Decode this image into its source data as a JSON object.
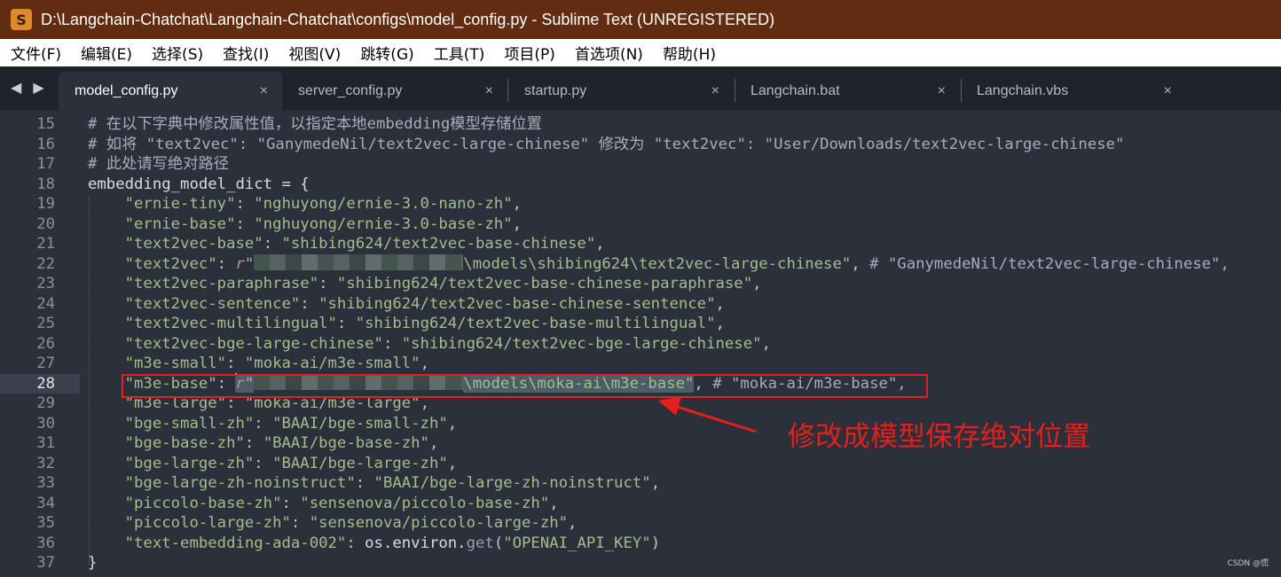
{
  "window": {
    "title": "D:\\Langchain-Chatchat\\Langchain-Chatchat\\configs\\model_config.py - Sublime Text (UNREGISTERED)",
    "app_icon_glyph": "S"
  },
  "menu": [
    "文件(F)",
    "编辑(E)",
    "选择(S)",
    "查找(I)",
    "视图(V)",
    "跳转(G)",
    "工具(T)",
    "项目(P)",
    "首选项(N)",
    "帮助(H)"
  ],
  "tabs": [
    {
      "label": "model_config.py",
      "active": true
    },
    {
      "label": "server_config.py",
      "active": false
    },
    {
      "label": "startup.py",
      "active": false
    },
    {
      "label": "Langchain.bat",
      "active": false
    },
    {
      "label": "Langchain.vbs",
      "active": false
    }
  ],
  "tab_close_glyph": "×",
  "nav_arrows": "◀ ▶",
  "current_line": 28,
  "code_lines": [
    {
      "n": "15",
      "parts": [
        {
          "t": "# 在以下字典中修改属性值，以指定本地embedding模型存储位置",
          "c": "c-comment"
        }
      ]
    },
    {
      "n": "16",
      "parts": [
        {
          "t": "# 如将 \"text2vec\": \"GanymedeNil/text2vec-large-chinese\" 修改为 \"text2vec\": \"User/Downloads/text2vec-large-chinese\"",
          "c": "c-comment"
        }
      ]
    },
    {
      "n": "17",
      "parts": [
        {
          "t": "# 此处请写绝对路径",
          "c": "c-comment"
        }
      ]
    },
    {
      "n": "18",
      "parts": [
        {
          "t": "embedding_model_dict = {",
          "c": "c-plain"
        }
      ]
    },
    {
      "n": "19",
      "parts": [
        {
          "t": "    \"ernie-tiny\"",
          "c": "c-key"
        },
        {
          "t": ": ",
          "c": "c-op"
        },
        {
          "t": "\"nghuyong/ernie-3.0-nano-zh\"",
          "c": "c-str"
        },
        {
          "t": ",",
          "c": "c-op"
        }
      ]
    },
    {
      "n": "20",
      "parts": [
        {
          "t": "    \"ernie-base\"",
          "c": "c-key"
        },
        {
          "t": ": ",
          "c": "c-op"
        },
        {
          "t": "\"nghuyong/ernie-3.0-base-zh\"",
          "c": "c-str"
        },
        {
          "t": ",",
          "c": "c-op"
        }
      ]
    },
    {
      "n": "21",
      "parts": [
        {
          "t": "    \"text2vec-base\"",
          "c": "c-key"
        },
        {
          "t": ": ",
          "c": "c-op"
        },
        {
          "t": "\"shibing624/text2vec-base-chinese\"",
          "c": "c-str"
        },
        {
          "t": ",",
          "c": "c-op"
        }
      ]
    },
    {
      "n": "22",
      "parts": [
        {
          "t": "    \"text2vec\"",
          "c": "c-key"
        },
        {
          "t": ": ",
          "c": "c-op"
        },
        {
          "t": "r",
          "c": "c-prefix"
        },
        {
          "t": "\"",
          "c": "c-str"
        },
        {
          "t": "",
          "c": "redacted"
        },
        {
          "t": "\\models\\shibing624\\text2vec-large-chinese\"",
          "c": "c-str"
        },
        {
          "t": ", ",
          "c": "c-op"
        },
        {
          "t": "# \"GanymedeNil/text2vec-large-chinese\",",
          "c": "c-comment"
        }
      ]
    },
    {
      "n": "23",
      "parts": [
        {
          "t": "    \"text2vec-paraphrase\"",
          "c": "c-key"
        },
        {
          "t": ": ",
          "c": "c-op"
        },
        {
          "t": "\"shibing624/text2vec-base-chinese-paraphrase\"",
          "c": "c-str"
        },
        {
          "t": ",",
          "c": "c-op"
        }
      ]
    },
    {
      "n": "24",
      "parts": [
        {
          "t": "    \"text2vec-sentence\"",
          "c": "c-key"
        },
        {
          "t": ": ",
          "c": "c-op"
        },
        {
          "t": "\"shibing624/text2vec-base-chinese-sentence\"",
          "c": "c-str"
        },
        {
          "t": ",",
          "c": "c-op"
        }
      ]
    },
    {
      "n": "25",
      "parts": [
        {
          "t": "    \"text2vec-multilingual\"",
          "c": "c-key"
        },
        {
          "t": ": ",
          "c": "c-op"
        },
        {
          "t": "\"shibing624/text2vec-base-multilingual\"",
          "c": "c-str"
        },
        {
          "t": ",",
          "c": "c-op"
        }
      ]
    },
    {
      "n": "26",
      "parts": [
        {
          "t": "    \"text2vec-bge-large-chinese\"",
          "c": "c-key"
        },
        {
          "t": ": ",
          "c": "c-op"
        },
        {
          "t": "\"shibing624/text2vec-bge-large-chinese\"",
          "c": "c-str"
        },
        {
          "t": ",",
          "c": "c-op"
        }
      ]
    },
    {
      "n": "27",
      "parts": [
        {
          "t": "    \"m3e-small\"",
          "c": "c-key"
        },
        {
          "t": ": ",
          "c": "c-op"
        },
        {
          "t": "\"moka-ai/m3e-small\"",
          "c": "c-str"
        },
        {
          "t": ",",
          "c": "c-op"
        }
      ]
    },
    {
      "n": "28",
      "parts": [
        {
          "t": "    \"m3e-base\"",
          "c": "c-key"
        },
        {
          "t": ": ",
          "c": "c-op"
        },
        {
          "t": "",
          "c": "caret"
        },
        {
          "t": "r",
          "c": "c-prefix sel"
        },
        {
          "t": "\"",
          "c": "c-str sel"
        },
        {
          "t": "",
          "c": "redacted"
        },
        {
          "t": "\\models\\moka-ai\\m3e-base\"",
          "c": "c-str sel"
        },
        {
          "t": ", ",
          "c": "c-op"
        },
        {
          "t": "# \"moka-ai/m3e-base\",",
          "c": "c-comment"
        }
      ]
    },
    {
      "n": "29",
      "parts": [
        {
          "t": "    \"m3e-large\"",
          "c": "c-key"
        },
        {
          "t": ": ",
          "c": "c-op"
        },
        {
          "t": "\"moka-ai/m3e-large\"",
          "c": "c-str"
        },
        {
          "t": ",",
          "c": "c-op"
        }
      ]
    },
    {
      "n": "30",
      "parts": [
        {
          "t": "    \"bge-small-zh\"",
          "c": "c-key"
        },
        {
          "t": ": ",
          "c": "c-op"
        },
        {
          "t": "\"BAAI/bge-small-zh\"",
          "c": "c-str"
        },
        {
          "t": ",",
          "c": "c-op"
        }
      ]
    },
    {
      "n": "31",
      "parts": [
        {
          "t": "    \"bge-base-zh\"",
          "c": "c-key"
        },
        {
          "t": ": ",
          "c": "c-op"
        },
        {
          "t": "\"BAAI/bge-base-zh\"",
          "c": "c-str"
        },
        {
          "t": ",",
          "c": "c-op"
        }
      ]
    },
    {
      "n": "32",
      "parts": [
        {
          "t": "    \"bge-large-zh\"",
          "c": "c-key"
        },
        {
          "t": ": ",
          "c": "c-op"
        },
        {
          "t": "\"BAAI/bge-large-zh\"",
          "c": "c-str"
        },
        {
          "t": ",",
          "c": "c-op"
        }
      ]
    },
    {
      "n": "33",
      "parts": [
        {
          "t": "    \"bge-large-zh-noinstruct\"",
          "c": "c-key"
        },
        {
          "t": ": ",
          "c": "c-op"
        },
        {
          "t": "\"BAAI/bge-large-zh-noinstruct\"",
          "c": "c-str"
        },
        {
          "t": ",",
          "c": "c-op"
        }
      ]
    },
    {
      "n": "34",
      "parts": [
        {
          "t": "    \"piccolo-base-zh\"",
          "c": "c-key"
        },
        {
          "t": ": ",
          "c": "c-op"
        },
        {
          "t": "\"sensenova/piccolo-base-zh\"",
          "c": "c-str"
        },
        {
          "t": ",",
          "c": "c-op"
        }
      ]
    },
    {
      "n": "35",
      "parts": [
        {
          "t": "    \"piccolo-large-zh\"",
          "c": "c-key"
        },
        {
          "t": ": ",
          "c": "c-op"
        },
        {
          "t": "\"sensenova/piccolo-large-zh\"",
          "c": "c-str"
        },
        {
          "t": ",",
          "c": "c-op"
        }
      ]
    },
    {
      "n": "36",
      "parts": [
        {
          "t": "    \"text-embedding-ada-002\"",
          "c": "c-key"
        },
        {
          "t": ": ",
          "c": "c-op"
        },
        {
          "t": "os.environ.",
          "c": "c-plain"
        },
        {
          "t": "get",
          "c": "c-fn"
        },
        {
          "t": "(",
          "c": "c-op"
        },
        {
          "t": "\"OPENAI_API_KEY\"",
          "c": "c-str"
        },
        {
          "t": ")",
          "c": "c-op"
        }
      ]
    },
    {
      "n": "37",
      "parts": [
        {
          "t": "}",
          "c": "c-plain"
        }
      ]
    }
  ],
  "annotation": {
    "text": "修改成模型保存绝对位置",
    "color": "#e3201b"
  },
  "watermark": "CSDN @慌"
}
